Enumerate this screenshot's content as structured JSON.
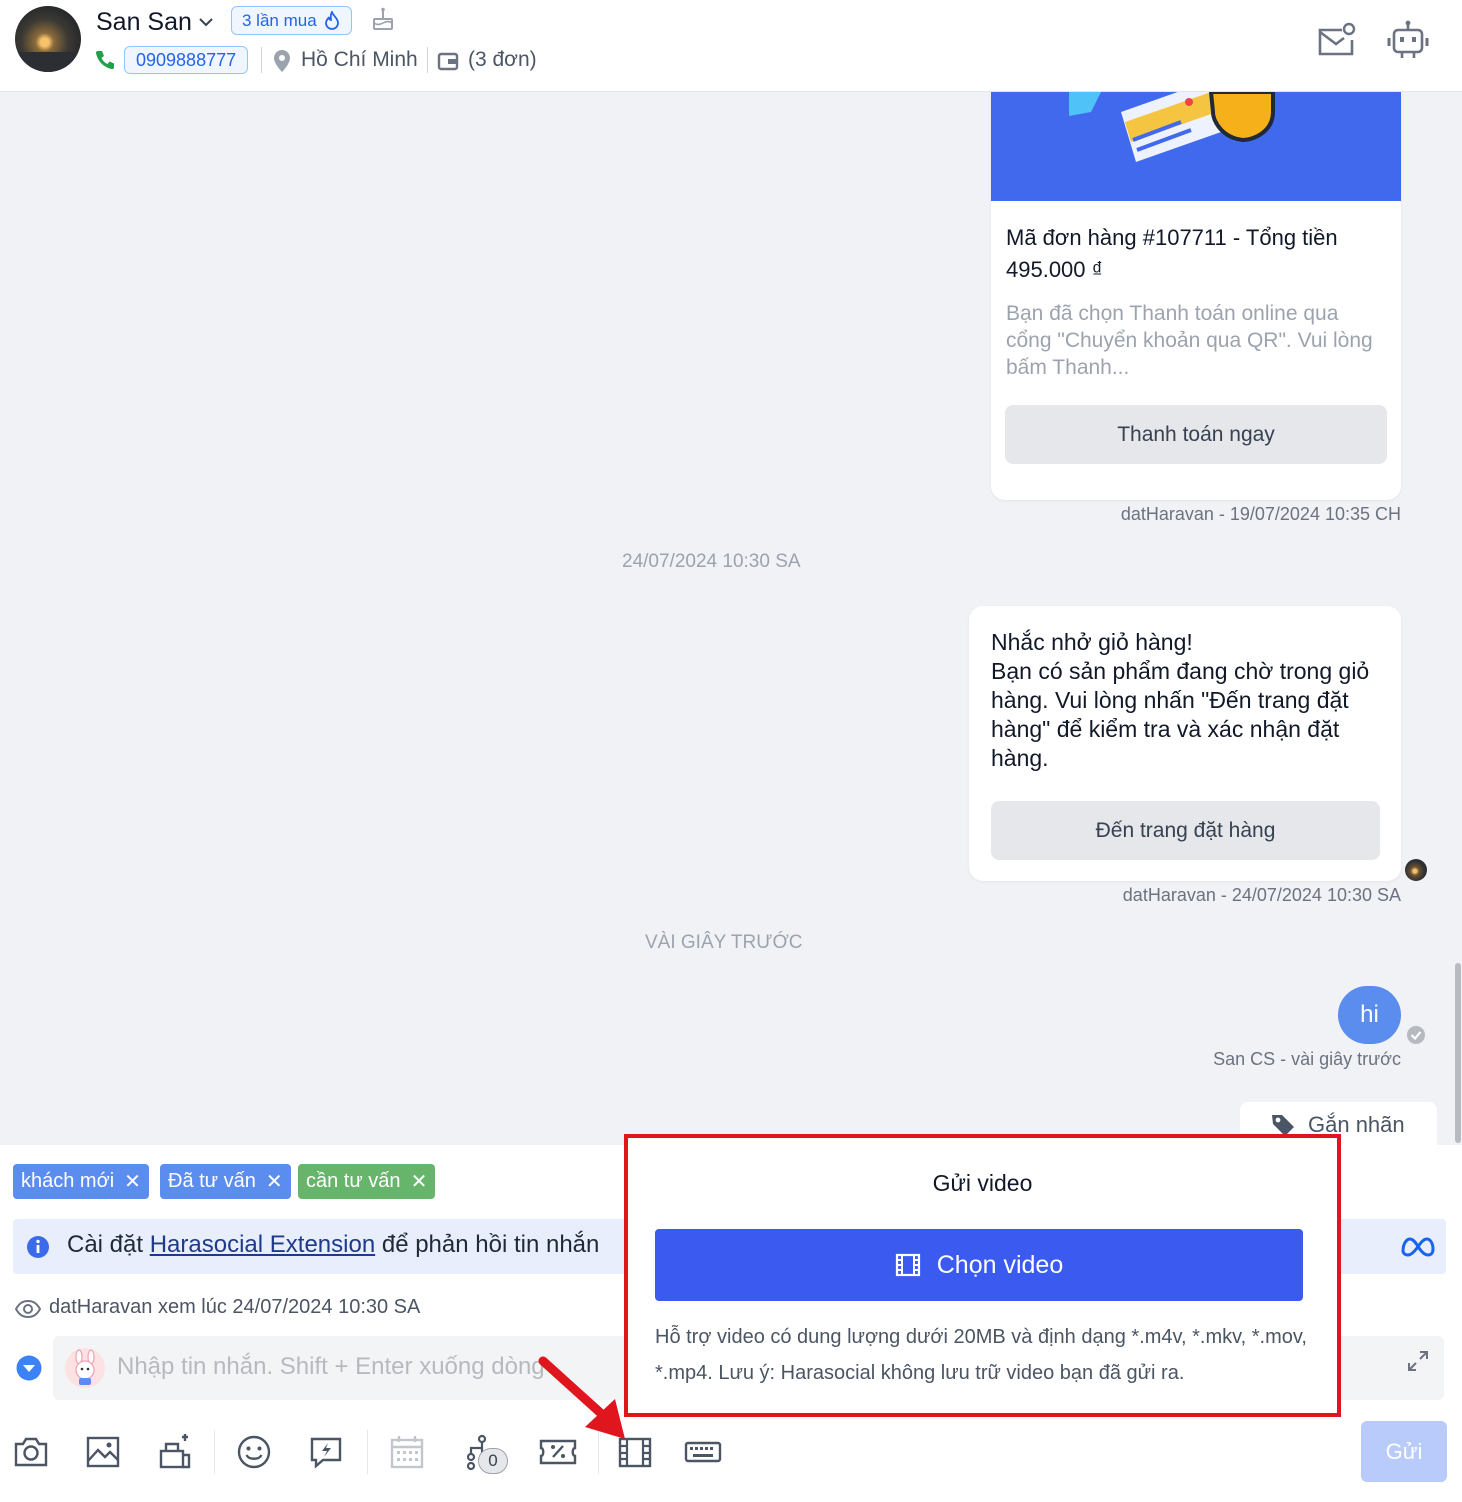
{
  "header": {
    "customer_name": "San San",
    "purchase_badge": "3 lần mua",
    "phone": "0909888777",
    "city": "Hồ Chí Minh",
    "orders": "(3 đơn)"
  },
  "chat": {
    "order_card": {
      "title": "Mã đơn hàng #107711 - Tổng tiền 495.000 ₫",
      "description": "Bạn đã chọn Thanh toán online qua cổng \"Chuyển khoản qua QR\". Vui lòng bấm Thanh...",
      "button": "Thanh toán ngay",
      "meta": "datHaravan - 19/07/2024 10:35 CH"
    },
    "divider_1": "24/07/2024 10:30 SA",
    "cart_card": {
      "text": "Nhắc nhở giỏ hàng!\nBạn có sản phẩm đang chờ trong giỏ hàng. Vui lòng nhấn \"Đến trang đặt hàng\" để kiểm tra và xác nhận đặt hàng.",
      "button": "Đến trang đặt hàng",
      "meta": "datHaravan - 24/07/2024 10:30 SA"
    },
    "divider_2": "VÀI GIÂY TRƯỚC",
    "hi_message": {
      "text": "hi",
      "meta": "San CS - vài giây trước"
    },
    "tag_button": "Gắn nhãn"
  },
  "composer": {
    "chips": [
      {
        "label": "khách mới",
        "color": "#5b8def"
      },
      {
        "label": "Đã tư vấn",
        "color": "#5b8def"
      },
      {
        "label": "cần tư vấn",
        "color": "#66b56b"
      }
    ],
    "info": {
      "prefix": "Cài đặt ",
      "link": "Harasocial Extension",
      "suffix": " để phản hồi tin nhắn"
    },
    "seen": "datHaravan xem lúc 24/07/2024 10:30 SA",
    "placeholder": "Nhập tin nhắn. Shift + Enter xuống dòng",
    "automation_count": "0",
    "send": "Gửi"
  },
  "video_popup": {
    "title": "Gửi video",
    "button": "Chọn video",
    "note": "Hỗ trợ video có dung lượng dưới 20MB và định dạng *.m4v, *.mkv, *.mov, *.mp4. Lưu ý: Harasocial không lưu trữ video bạn đã gửi ra."
  },
  "colors": {
    "primary": "#3b5bf0",
    "highlight_border": "#e0161e",
    "bubble": "#5b8def"
  }
}
